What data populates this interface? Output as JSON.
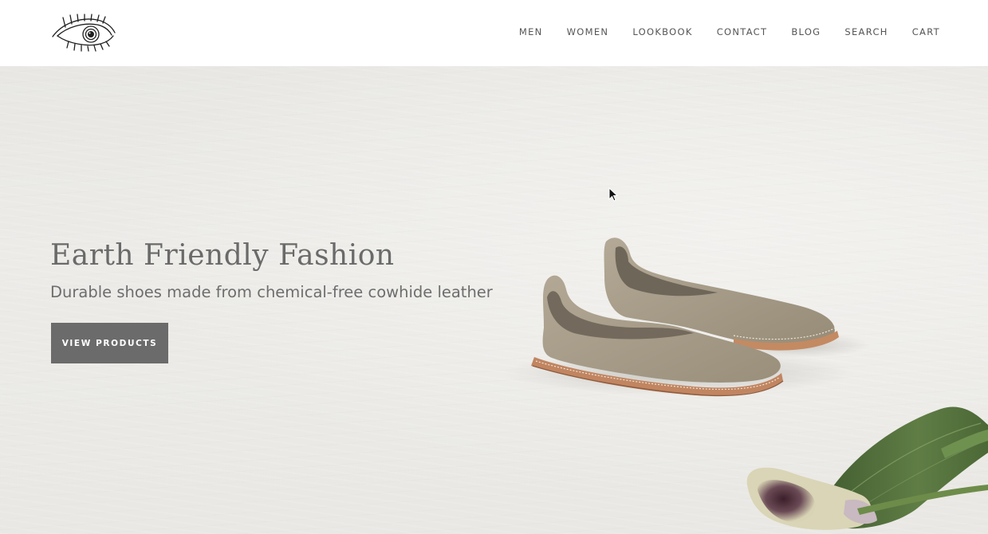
{
  "header": {
    "logo_icon": "eye-logo-icon",
    "nav": [
      {
        "label": "MEN"
      },
      {
        "label": "WOMEN"
      },
      {
        "label": "LOOKBOOK"
      },
      {
        "label": "CONTACT"
      },
      {
        "label": "BLOG"
      },
      {
        "label": "SEARCH"
      },
      {
        "label": "CART"
      }
    ]
  },
  "hero": {
    "title": "Earth Friendly Fashion",
    "subtitle": "Durable shoes made from chemical-free cowhide leather",
    "button_label": "VIEW PRODUCTS"
  },
  "colors": {
    "nav_text": "#555555",
    "button_bg": "#6b6b6b",
    "button_text": "#ffffff",
    "hero_bg": "#eae9e5",
    "shoe": "#a49a88",
    "leaf": "#4f6b3b"
  }
}
